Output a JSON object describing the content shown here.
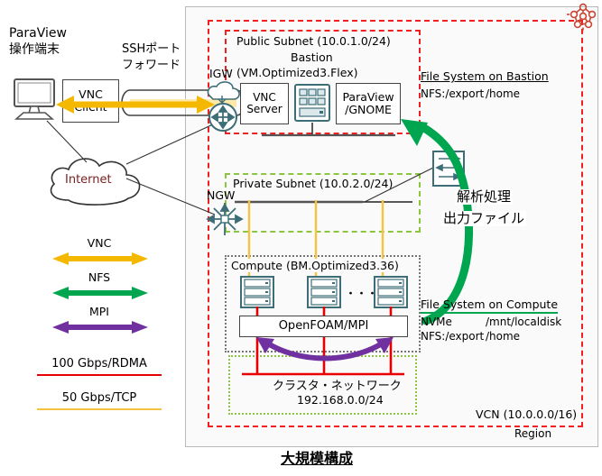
{
  "title": "大規模構成",
  "colors": {
    "vcn_border": "#f02020",
    "subnet_public": "#f02020",
    "subnet_private": "#8cc63f",
    "vnc_yellow": "#f5b800",
    "nfs_green": "#00a550",
    "mpi_purple": "#7030a0",
    "rdma_red": "#e80000",
    "tcp_yellow": "#f5c242",
    "device_teal": "#3d6e78",
    "oracle_orange": "#c74634"
  },
  "client_side": {
    "terminal_label_line1": "ParaView",
    "terminal_label_line2": "操作端末",
    "vnc_client_line1": "VNC",
    "vnc_client_line2": "Client",
    "tunnel_label_line1": "SSHポート",
    "tunnel_label_line2": "フォワード",
    "internet_label": "Internet"
  },
  "region": {
    "label": "Region",
    "vcn_label": "VCN (10.0.0.0/16)"
  },
  "public_subnet": {
    "title": "Public Subnet (10.0.1.0/24)",
    "subtitle": "Bastion",
    "shape": "(VM.Optimized3.Flex)",
    "igw_label": "IGW",
    "vnc_server_line1": "VNC",
    "vnc_server_line2": "Server",
    "paraview_line1": "ParaView",
    "paraview_line2": "/GNOME"
  },
  "private_subnet": {
    "title": "Private Subnet (10.0.2.0/24)",
    "ngw_label": "NGW"
  },
  "compute": {
    "title": "Compute (BM.Optimized3.36)",
    "ellipsis": "・・・",
    "mpi_box_label": "OpenFOAM/MPI"
  },
  "cluster_network": {
    "line1": "クラスタ・ネットワーク",
    "line2": "192.168.0.0/24"
  },
  "filesystem_bastion": {
    "heading": "File System on Bastion",
    "rows": [
      {
        "proto": "NFS:/export",
        "mount": "/home"
      }
    ]
  },
  "filesystem_compute": {
    "heading": "File System on Compute",
    "rows": [
      {
        "proto": "NVMe",
        "mount": "/mnt/localdisk"
      },
      {
        "proto": "NFS:/export",
        "mount": "/home"
      }
    ]
  },
  "flow_annotation": {
    "line1": "解析処理",
    "line2": "出力ファイル"
  },
  "legend": {
    "arrows": [
      {
        "label": "VNC",
        "color": "#f5b800"
      },
      {
        "label": "NFS",
        "color": "#00a550"
      },
      {
        "label": "MPI",
        "color": "#7030a0"
      }
    ],
    "rules": [
      {
        "label": "100 Gbps/RDMA",
        "color": "#e80000"
      },
      {
        "label": "50 Gbps/TCP",
        "color": "#f5c242"
      }
    ]
  }
}
